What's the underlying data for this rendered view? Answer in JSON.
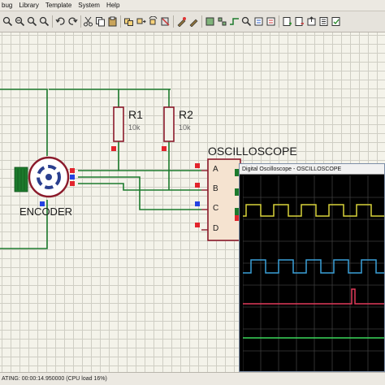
{
  "menu": {
    "items": [
      "bug",
      "Library",
      "Template",
      "System",
      "Help"
    ]
  },
  "toolbar": {
    "buttons": [
      "zoom-in-icon",
      "zoom-out-icon",
      "zoom-all-icon",
      "zoom-area-icon",
      "undo-icon",
      "redo-icon",
      "cut-icon",
      "copy-icon",
      "paste-icon",
      "block-copy-icon",
      "block-move-icon",
      "block-rotate-icon",
      "block-delete-icon",
      "pick-device-icon",
      "make-device-icon",
      "packaging-icon",
      "decompose-icon",
      "wire-autorouter-icon",
      "search-icon",
      "property-tool-icon",
      "design-explorer-icon",
      "new-sheet-icon",
      "remove-sheet-icon",
      "exit-to-parent-icon",
      "bom-icon",
      "erc-icon"
    ]
  },
  "schematic": {
    "components": {
      "r1": {
        "ref": "R1",
        "value": "10k"
      },
      "r2": {
        "ref": "R2",
        "value": "10k"
      },
      "encoder": {
        "label": "ENCODER"
      },
      "oscilloscope": {
        "label": "OSCILLOSCOPE",
        "pins": [
          "A",
          "B",
          "C",
          "D"
        ]
      }
    },
    "wire_color": "#1c7a2c",
    "component_color": "#8b1a2b",
    "pin_marker_colors": {
      "red": "#e2242c",
      "blue": "#2442e2"
    }
  },
  "oscilloscope_window": {
    "title": "Digital Oscilloscope - OSCILLOSCOPE",
    "traces": [
      {
        "channel": "A",
        "color": "#d8d23a"
      },
      {
        "channel": "B",
        "color": "#3aa0d8"
      },
      {
        "channel": "C",
        "color": "#e23a5a"
      },
      {
        "channel": "D",
        "color": "#3ad85a"
      }
    ]
  },
  "status": {
    "text": "ATING: 00:00:14.950000 (CPU load 16%)"
  }
}
